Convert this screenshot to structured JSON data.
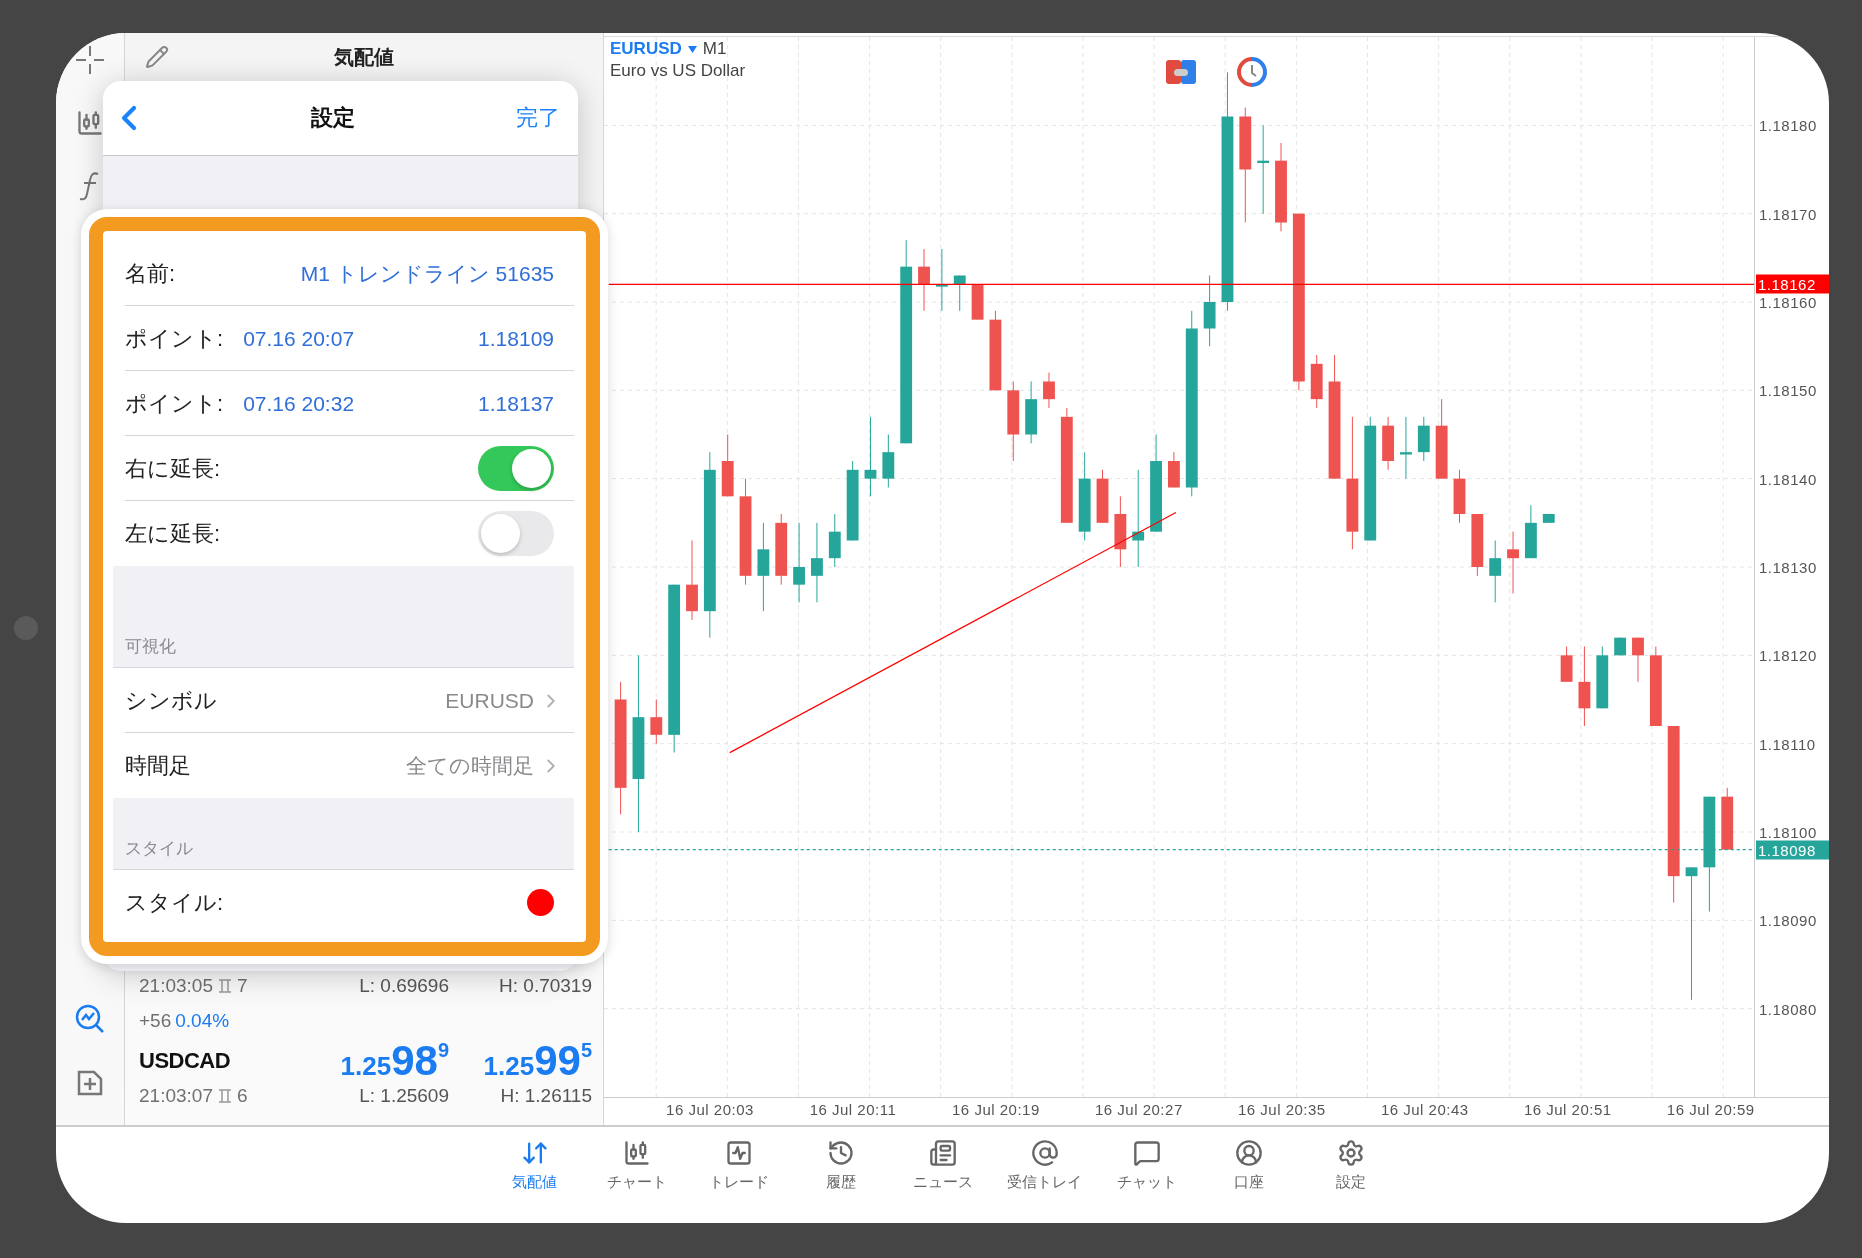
{
  "quotes": {
    "title": "気配値",
    "lines": [
      {
        "kind": "stats",
        "time": "21:03:05",
        "spread": "7",
        "low": "L: 0.69696",
        "high": "H: 0.70319"
      },
      {
        "kind": "change",
        "points": "+56",
        "percent": "0.04%"
      },
      {
        "kind": "price",
        "symbol": "USDCAD",
        "bid": {
          "lead": "1.25",
          "big": "98",
          "small": "9"
        },
        "ask": {
          "lead": "1.25",
          "big": "99",
          "small": "5"
        }
      },
      {
        "kind": "stats",
        "time": "21:03:07",
        "spread": "6",
        "low": "L: 1.25609",
        "high": "H: 1.26115"
      }
    ]
  },
  "settings": {
    "title": "設定",
    "done": "完了",
    "rows": [
      {
        "kind": "text",
        "label": "名前:",
        "value": "M1 トレンドライン 51635"
      },
      {
        "kind": "point",
        "label": "ポイント:",
        "time": "07.16 20:07",
        "price": "1.18109"
      },
      {
        "kind": "point",
        "label": "ポイント:",
        "time": "07.16 20:32",
        "price": "1.18137"
      },
      {
        "kind": "toggle",
        "label": "右に延長:",
        "on": true
      },
      {
        "kind": "toggle",
        "label": "左に延長:",
        "on": false
      },
      {
        "kind": "section",
        "label": "可視化"
      },
      {
        "kind": "link",
        "label": "シンボル",
        "value": "EURUSD"
      },
      {
        "kind": "link",
        "label": "時間足",
        "value": "全ての時間足"
      },
      {
        "kind": "section",
        "label": "スタイル"
      },
      {
        "kind": "color",
        "label": "スタイル:",
        "color": "#ff0000"
      }
    ]
  },
  "chart": {
    "symbol": "EURUSD",
    "timeframe": "M1",
    "description": "Euro vs US Dollar",
    "chart_data": {
      "type": "candlestick",
      "ylim": [
        1.1807,
        1.1819
      ],
      "categories": [
        null,
        null,
        null,
        null,
        null,
        "16 Jul 20:03",
        null,
        null,
        null,
        null,
        null,
        null,
        null,
        "16 Jul 20:11",
        null,
        null,
        null,
        null,
        null,
        null,
        null,
        "16 Jul 20:19",
        null,
        null,
        null,
        null,
        null,
        null,
        null,
        "16 Jul 20:27",
        null,
        null,
        null,
        null,
        null,
        null,
        null,
        "16 Jul 20:35",
        null,
        null,
        null,
        null,
        null,
        null,
        null,
        "16 Jul 20:43",
        null,
        null,
        null,
        null,
        null,
        null,
        null,
        "16 Jul 20:51",
        null,
        null,
        null,
        null,
        null,
        null,
        null,
        "16 Jul 20:59",
        null
      ],
      "ohlc": [
        [
          1.18115,
          1.18117,
          1.18102,
          1.18105
        ],
        [
          1.18106,
          1.1812,
          1.181,
          1.18113
        ],
        [
          1.18113,
          1.18115,
          1.1811,
          1.18111
        ],
        [
          1.18111,
          1.18128,
          1.18109,
          1.18128
        ],
        [
          1.18128,
          1.18133,
          1.18124,
          1.18125
        ],
        [
          1.18125,
          1.18143,
          1.18122,
          1.18141
        ],
        [
          1.18142,
          1.18145,
          1.18138,
          1.18138
        ],
        [
          1.18138,
          1.1814,
          1.18128,
          1.18129
        ],
        [
          1.18129,
          1.18135,
          1.18125,
          1.18132
        ],
        [
          1.18135,
          1.18136,
          1.18128,
          1.18129
        ],
        [
          1.18128,
          1.18135,
          1.18126,
          1.1813
        ],
        [
          1.18129,
          1.18135,
          1.18126,
          1.18131
        ],
        [
          1.18131,
          1.18136,
          1.1813,
          1.18134
        ],
        [
          1.18133,
          1.18142,
          1.18133,
          1.18141
        ],
        [
          1.1814,
          1.18147,
          1.18138,
          1.18141
        ],
        [
          1.1814,
          1.18145,
          1.18139,
          1.18143
        ],
        [
          1.18144,
          1.18167,
          1.18144,
          1.18164
        ],
        [
          1.18164,
          1.18166,
          1.18159,
          1.18162
        ],
        [
          1.18162,
          1.18166,
          1.18159,
          1.18162
        ],
        [
          1.18162,
          1.18163,
          1.18159,
          1.18163
        ],
        [
          1.18162,
          1.18162,
          1.18158,
          1.18158
        ],
        [
          1.18158,
          1.18159,
          1.1815,
          1.1815
        ],
        [
          1.1815,
          1.18151,
          1.18142,
          1.18145
        ],
        [
          1.18145,
          1.18151,
          1.18144,
          1.18149
        ],
        [
          1.18151,
          1.18152,
          1.18148,
          1.18149
        ],
        [
          1.18147,
          1.18148,
          1.18135,
          1.18135
        ],
        [
          1.18134,
          1.18143,
          1.18133,
          1.1814
        ],
        [
          1.1814,
          1.18141,
          1.18135,
          1.18135
        ],
        [
          1.18136,
          1.18138,
          1.1813,
          1.18132
        ],
        [
          1.18133,
          1.18141,
          1.1813,
          1.18134
        ],
        [
          1.18134,
          1.18145,
          1.18134,
          1.18142
        ],
        [
          1.18142,
          1.18143,
          1.18139,
          1.18139
        ],
        [
          1.18139,
          1.18159,
          1.18138,
          1.18157
        ],
        [
          1.18157,
          1.18163,
          1.18155,
          1.1816
        ],
        [
          1.1816,
          1.18186,
          1.18159,
          1.18181
        ],
        [
          1.18181,
          1.18182,
          1.18169,
          1.18175
        ],
        [
          1.18176,
          1.1818,
          1.1817,
          1.18176
        ],
        [
          1.18176,
          1.18178,
          1.18168,
          1.18169
        ],
        [
          1.1817,
          1.1817,
          1.1815,
          1.18151
        ],
        [
          1.18153,
          1.18154,
          1.18148,
          1.18149
        ],
        [
          1.18151,
          1.18154,
          1.1814,
          1.1814
        ],
        [
          1.1814,
          1.18147,
          1.18132,
          1.18134
        ],
        [
          1.18133,
          1.18147,
          1.18133,
          1.18146
        ],
        [
          1.18146,
          1.18147,
          1.18141,
          1.18142
        ],
        [
          1.18143,
          1.18147,
          1.1814,
          1.18143
        ],
        [
          1.18143,
          1.18147,
          1.18142,
          1.18146
        ],
        [
          1.18146,
          1.18149,
          1.1814,
          1.1814
        ],
        [
          1.1814,
          1.18141,
          1.18135,
          1.18136
        ],
        [
          1.18136,
          1.18136,
          1.18129,
          1.1813
        ],
        [
          1.18129,
          1.18133,
          1.18126,
          1.18131
        ],
        [
          1.18132,
          1.18134,
          1.18127,
          1.18131
        ],
        [
          1.18131,
          1.18137,
          1.18131,
          1.18135
        ],
        [
          1.18135,
          1.18136,
          1.18135,
          1.18136
        ],
        [
          1.1812,
          1.18121,
          1.18117,
          1.18117
        ],
        [
          1.18117,
          1.18121,
          1.18112,
          1.18114
        ],
        [
          1.18114,
          1.18121,
          1.18114,
          1.1812
        ],
        [
          1.1812,
          1.18122,
          1.1812,
          1.18122
        ],
        [
          1.18122,
          1.18122,
          1.18117,
          1.1812
        ],
        [
          1.1812,
          1.18121,
          1.18112,
          1.18112
        ],
        [
          1.18112,
          1.18112,
          1.18092,
          1.18095
        ],
        [
          1.18095,
          1.18096,
          1.18081,
          1.18096
        ],
        [
          1.18096,
          1.18104,
          1.18091,
          1.18104
        ],
        [
          1.18104,
          1.18105,
          1.18098,
          1.18098
        ]
      ],
      "yticks": [
        {
          "value": 1.1818,
          "label": "1.18180"
        },
        {
          "value": 1.1817,
          "label": "1.18170"
        },
        {
          "value": 1.1816,
          "label": "1.18160"
        },
        {
          "value": 1.1815,
          "label": "1.18150"
        },
        {
          "value": 1.1814,
          "label": "1.18140"
        },
        {
          "value": 1.1813,
          "label": "1.18130"
        },
        {
          "value": 1.1812,
          "label": "1.18120"
        },
        {
          "value": 1.1811,
          "label": "1.18110"
        },
        {
          "value": 1.181,
          "label": "1.18100"
        },
        {
          "value": 1.1809,
          "label": "1.18090"
        },
        {
          "value": 1.1808,
          "label": "1.18080"
        }
      ],
      "grid": true,
      "ref_lines": [
        {
          "axis": "y",
          "value": 1.18162,
          "label": "1.18162",
          "color": "#ff0000"
        },
        {
          "axis": "y",
          "value": 1.18098,
          "label": "1.18098",
          "color": "#26a69a"
        }
      ]
    }
  },
  "tab_bar": [
    {
      "kind": "quotes",
      "label": "気配値",
      "selected": true
    },
    {
      "kind": "chart",
      "label": "チャート",
      "selected": false
    },
    {
      "kind": "trade",
      "label": "トレード",
      "selected": false
    },
    {
      "kind": "history",
      "label": "履歴",
      "selected": false
    },
    {
      "kind": "news",
      "label": "ニュース",
      "selected": false
    },
    {
      "kind": "mailbox",
      "label": "受信トレイ",
      "selected": false
    },
    {
      "kind": "chat",
      "label": "チャット",
      "selected": false
    },
    {
      "kind": "account",
      "label": "口座",
      "selected": false
    },
    {
      "kind": "settings",
      "label": "設定",
      "selected": false
    }
  ]
}
